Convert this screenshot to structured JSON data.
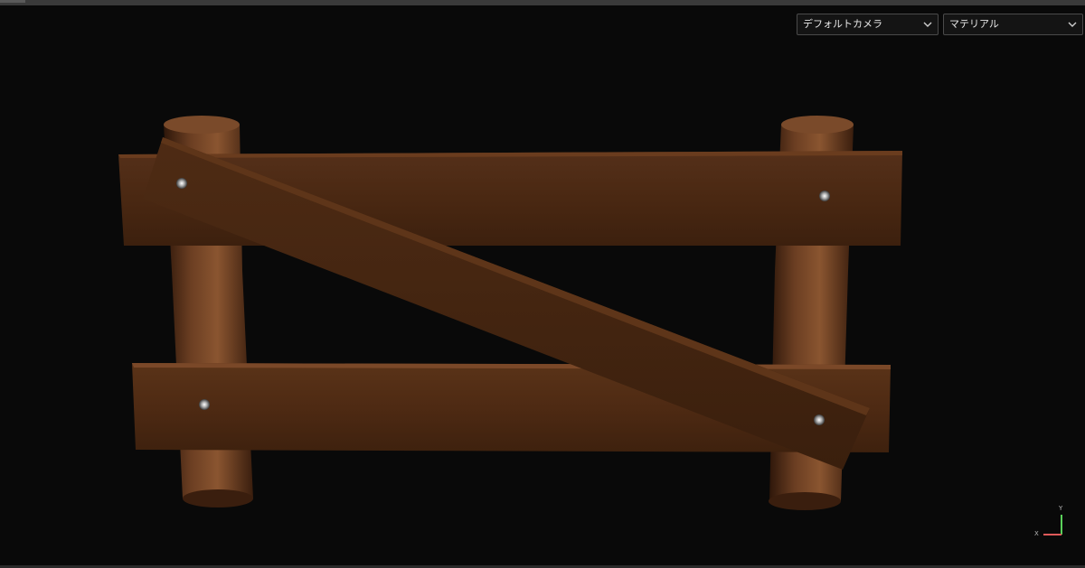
{
  "toolbar": {
    "camera_select": "デフォルトカメラ",
    "material_select": "マテリアル"
  },
  "gizmo": {
    "x_label": "X",
    "y_label": "Y"
  },
  "colors": {
    "background": "#090909",
    "wood_plank": "#4a2812",
    "wood_post": "#6b3e22",
    "gizmo_x": "#e05a5a",
    "gizmo_y": "#5ad05a"
  },
  "icons": {
    "dropdown": "chevron-down-icon"
  }
}
